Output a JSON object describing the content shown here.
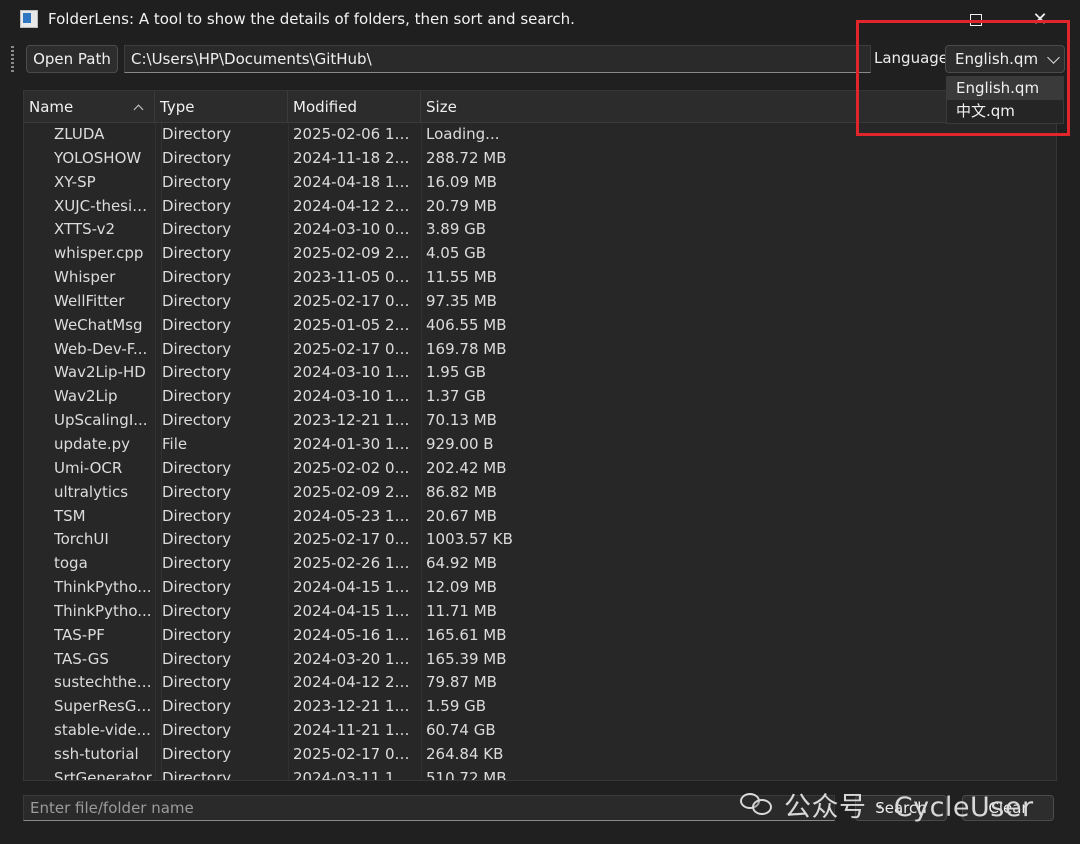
{
  "window": {
    "title": "FolderLens: A tool to show the details of folders, then sort and search.",
    "minimize_symbol": "",
    "maximize_symbol": "",
    "close_symbol": "✕"
  },
  "toolbar": {
    "open_path_label": "Open Path",
    "path_value": "C:\\Users\\HP\\Documents\\GitHub\\",
    "language_label": "Language",
    "language_selected": "English.qm"
  },
  "language_dropdown": {
    "options": [
      "English.qm",
      "中文.qm"
    ]
  },
  "table": {
    "headers": [
      "Name",
      "Type",
      "Modified",
      "Size"
    ],
    "rows": [
      {
        "name": "ZLUDA",
        "type": "Directory",
        "modified": "2025-02-06 10:...",
        "size": "Loading..."
      },
      {
        "name": "YOLOSHOW",
        "type": "Directory",
        "modified": "2024-11-18 21:...",
        "size": "288.72 MB"
      },
      {
        "name": "XY-SP",
        "type": "Directory",
        "modified": "2024-04-18 18:...",
        "size": "16.09 MB"
      },
      {
        "name": "XUJC-thesis...",
        "type": "Directory",
        "modified": "2024-04-12 22:...",
        "size": "20.79 MB"
      },
      {
        "name": "XTTS-v2",
        "type": "Directory",
        "modified": "2024-03-10 07:...",
        "size": "3.89 GB"
      },
      {
        "name": "whisper.cpp",
        "type": "Directory",
        "modified": "2025-02-09 23:...",
        "size": "4.05 GB"
      },
      {
        "name": "Whisper",
        "type": "Directory",
        "modified": "2023-11-05 08:...",
        "size": "11.55 MB"
      },
      {
        "name": "WellFitter",
        "type": "Directory",
        "modified": "2025-02-17 00:...",
        "size": "97.35 MB"
      },
      {
        "name": "WeChatMsg",
        "type": "Directory",
        "modified": "2025-01-05 22:...",
        "size": "406.55 MB"
      },
      {
        "name": "Web-Dev-F...",
        "type": "Directory",
        "modified": "2025-02-17 00:...",
        "size": "169.78 MB"
      },
      {
        "name": "Wav2Lip-HD",
        "type": "Directory",
        "modified": "2024-03-10 16:...",
        "size": "1.95 GB"
      },
      {
        "name": "Wav2Lip",
        "type": "Directory",
        "modified": "2024-03-10 13:...",
        "size": "1.37 GB"
      },
      {
        "name": "UpScalingI...",
        "type": "Directory",
        "modified": "2023-12-21 16:...",
        "size": "70.13 MB"
      },
      {
        "name": "update.py",
        "type": "File",
        "modified": "2024-01-30 13:...",
        "size": "929.00 B"
      },
      {
        "name": "Umi-OCR",
        "type": "Directory",
        "modified": "2025-02-02 08:...",
        "size": "202.42 MB"
      },
      {
        "name": "ultralytics",
        "type": "Directory",
        "modified": "2025-02-09 23:...",
        "size": "86.82 MB"
      },
      {
        "name": "TSM",
        "type": "Directory",
        "modified": "2024-05-23 12:...",
        "size": "20.67 MB"
      },
      {
        "name": "TorchUI",
        "type": "Directory",
        "modified": "2025-02-17 07:...",
        "size": "1003.57 KB"
      },
      {
        "name": "toga",
        "type": "Directory",
        "modified": "2025-02-26 18:...",
        "size": "64.92 MB"
      },
      {
        "name": "ThinkPytho...",
        "type": "Directory",
        "modified": "2024-04-15 16:...",
        "size": "12.09 MB"
      },
      {
        "name": "ThinkPytho...",
        "type": "Directory",
        "modified": "2024-04-15 16:...",
        "size": "11.71 MB"
      },
      {
        "name": "TAS-PF",
        "type": "Directory",
        "modified": "2024-05-16 18:...",
        "size": "165.61 MB"
      },
      {
        "name": "TAS-GS",
        "type": "Directory",
        "modified": "2024-03-20 16:...",
        "size": "165.39 MB"
      },
      {
        "name": "sustechthesi...",
        "type": "Directory",
        "modified": "2024-04-12 22:...",
        "size": "79.87 MB"
      },
      {
        "name": "SuperResGAN",
        "type": "Directory",
        "modified": "2023-12-21 18:...",
        "size": "1.59 GB"
      },
      {
        "name": "stable-vide...",
        "type": "Directory",
        "modified": "2024-11-21 19:...",
        "size": "60.74 GB"
      },
      {
        "name": "ssh-tutorial",
        "type": "Directory",
        "modified": "2025-02-17 07:...",
        "size": "264.84 KB"
      },
      {
        "name": "SrtGenerator",
        "type": "Directory",
        "modified": "2024-03-11 11:...",
        "size": "510.72 MB"
      }
    ]
  },
  "search": {
    "placeholder": "Enter file/folder name",
    "search_label": "Search",
    "clear_label": "Clear"
  },
  "watermark": {
    "text": "公众号 · CycleUser"
  },
  "colors": {
    "background": "#202020",
    "highlight_box": "#e0262a"
  }
}
